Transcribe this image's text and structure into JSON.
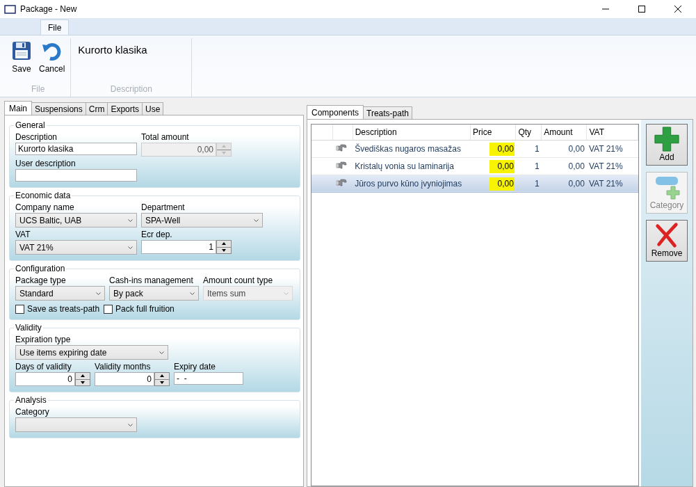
{
  "window": {
    "title": "Package - New"
  },
  "ribbon": {
    "tabs": [
      {
        "label": "File",
        "selected": true
      }
    ],
    "groups": [
      {
        "label": "File",
        "buttons": [
          {
            "label": "Save"
          },
          {
            "label": "Cancel"
          }
        ]
      },
      {
        "label": "Description",
        "text": "Kurorto klasika"
      }
    ]
  },
  "main_tabs": [
    {
      "label": "Main",
      "selected": true
    },
    {
      "label": "Suspensions",
      "selected": false
    },
    {
      "label": "Crm",
      "selected": false
    },
    {
      "label": "Exports",
      "selected": false
    },
    {
      "label": "Use",
      "selected": false
    }
  ],
  "groups": [
    {
      "title": "General",
      "rows": [
        [
          {
            "kind": "text",
            "label": "Description",
            "value": "Kurorto klasika",
            "disabled": false
          },
          {
            "kind": "spin",
            "label": "Total amount",
            "value": "0,00",
            "disabled": true
          }
        ],
        [
          {
            "kind": "text",
            "label": "User description",
            "disabled": false
          }
        ]
      ]
    },
    {
      "title": "Economic data",
      "rows": [
        [
          {
            "kind": "combo",
            "label": "Company name",
            "value": "UCS Baltic, UAB",
            "disabled": false
          },
          {
            "kind": "combo",
            "label": "Department",
            "value": "SPA-Well",
            "disabled": false
          }
        ],
        [
          {
            "kind": "combo",
            "label": "VAT",
            "value": "VAT 21%",
            "disabled": false
          },
          {
            "kind": "spin",
            "label": "Ecr dep.",
            "value": "1",
            "disabled": false
          }
        ]
      ]
    },
    {
      "title": "Configuration",
      "rows": [
        [
          {
            "kind": "combo",
            "label": "Package type",
            "value": "Standard",
            "disabled": false
          },
          {
            "kind": "combo",
            "label": "Cash-ins management",
            "value": "By pack",
            "disabled": false
          },
          {
            "kind": "combo",
            "label": "Amount count type",
            "value": "Items sum",
            "disabled": true
          }
        ],
        [
          {
            "kind": "check",
            "label": "Save as treats-path",
            "checked": false
          },
          {
            "kind": "check",
            "label": "Pack full fruition",
            "checked": false
          }
        ]
      ]
    },
    {
      "title": "Validity",
      "rows": [
        [
          {
            "kind": "combo",
            "label": "Expiration type",
            "value": "Use items expiring date",
            "disabled": false
          }
        ],
        [
          {
            "kind": "spin",
            "label": "Days of validity",
            "value": "0",
            "disabled": false
          },
          {
            "kind": "spin",
            "label": "Validity months",
            "value": "0",
            "disabled": false
          },
          {
            "kind": "text",
            "label": "Expiry date",
            "value": "-  -",
            "disabled": false
          }
        ]
      ]
    },
    {
      "title": "Analysis",
      "rows": [
        [
          {
            "kind": "combo",
            "label": "Category",
            "disabled": false
          }
        ]
      ]
    }
  ],
  "components": {
    "tabs": [
      {
        "label": "Components",
        "selected": true
      },
      {
        "label": "Treats-path",
        "selected": false
      }
    ],
    "columns": [
      "Description",
      "Price",
      "Qty",
      "Amount",
      "VAT"
    ],
    "rows": [
      {
        "description": "Švediškas nugaros masažas",
        "price": "0,00",
        "qty": "1",
        "amount": "0,00",
        "vat": "VAT 21%",
        "selected": false,
        "highlighted": true
      },
      {
        "description": "Kristalų vonia su laminarija",
        "price": "0,00",
        "qty": "1",
        "amount": "0,00",
        "vat": "VAT 21%",
        "selected": false,
        "highlighted": true
      },
      {
        "description": "Jūros purvo kūno įvyniojimas",
        "price": "0,00",
        "qty": "1",
        "amount": "0,00",
        "vat": "VAT 21%",
        "selected": true,
        "highlighted": true
      }
    ]
  },
  "side_buttons": [
    {
      "label": "Add",
      "disabled": false
    },
    {
      "label": "Category",
      "disabled": true
    },
    {
      "label": "Remove",
      "disabled": false
    }
  ]
}
